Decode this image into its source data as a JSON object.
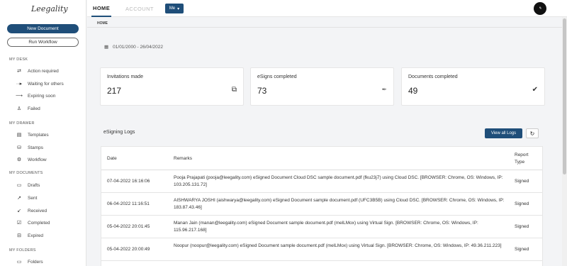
{
  "brand": {
    "name": "Leegality"
  },
  "sidebar": {
    "new_document": "New Document",
    "run_workflow": "Run Workflow",
    "sections": [
      {
        "title": "MY DESK",
        "items": [
          {
            "label": "Action required",
            "icon": "arrows-icon"
          },
          {
            "label": "Waiting for others",
            "icon": "dash-arrow-icon"
          },
          {
            "label": "Expiring soon",
            "icon": "arrow-right-icon"
          },
          {
            "label": "Failed",
            "icon": "figure-icon"
          }
        ]
      },
      {
        "title": "MY DRAWER",
        "items": [
          {
            "label": "Templates",
            "icon": "templates-icon"
          },
          {
            "label": "Stamps",
            "icon": "stamp-icon"
          },
          {
            "label": "Workflow",
            "icon": "workflow-icon"
          }
        ]
      },
      {
        "title": "MY DOCUMENTS",
        "items": [
          {
            "label": "Drafts",
            "icon": "draft-icon"
          },
          {
            "label": "Sent",
            "icon": "sent-icon"
          },
          {
            "label": "Received",
            "icon": "received-icon"
          },
          {
            "label": "Completed",
            "icon": "completed-icon"
          },
          {
            "label": "Expired",
            "icon": "expired-icon"
          }
        ]
      },
      {
        "title": "MY FOLDERS",
        "items": [
          {
            "label": "Folders",
            "icon": "folder-icon"
          }
        ]
      }
    ]
  },
  "topbar": {
    "tabs": [
      "HOME",
      "ACCOUNT"
    ],
    "me_label": "Me"
  },
  "breadcrumb": "HOME",
  "date_range": "01/01/2000 - 26/04/2022",
  "cards": [
    {
      "title": "Invitations made",
      "value": "217",
      "icon": "external-link-icon"
    },
    {
      "title": "eSigns completed",
      "value": "73",
      "icon": "signature-icon"
    },
    {
      "title": "Documents completed",
      "value": "49",
      "icon": "checkmark-icon"
    }
  ],
  "logs": {
    "title": "eSigning Logs",
    "view_all": "View all Logs",
    "headers": {
      "date": "Date",
      "remarks": "Remarks",
      "report_line1": "Report",
      "report_line2": "Type"
    },
    "rows": [
      {
        "date": "07-04-2022 16:16:06",
        "remarks": "Pooja Prajapati (pooja@leegality.com) eSigned Document Cloud DSC sample document.pdf (fku23j7) using Cloud DSC. [BROWSER: Chrome, OS: Windows, IP: 103.205.131.72]",
        "type": "Signed"
      },
      {
        "date": "06-04-2022 11:16:51",
        "remarks": "AISHWARYA JOSHI (aishwarya@leegality.com) eSigned Document sample document.pdf (UFC3B5B) using Cloud DSC. [BROWSER: Chrome, OS: Windows, IP: 183.87.43.46]",
        "type": "Signed"
      },
      {
        "date": "05-04-2022 20:01:45",
        "remarks": "Manan Jain (manan@leegality.com) eSigned Document sample document.pdf (melLMox) using Virtual Sign. [BROWSER: Chrome, OS: Windows, IP: 115.96.217.168]",
        "type": "Signed"
      },
      {
        "date": "05-04-2022 20:00:49",
        "remarks": "Noopur (noopur@leegality.com) eSigned Document sample document.pdf (melLMox) using Virtual Sign. [BROWSER: Chrome, OS: Windows, IP: 49.36.211.223]",
        "type": "Signed"
      }
    ]
  }
}
